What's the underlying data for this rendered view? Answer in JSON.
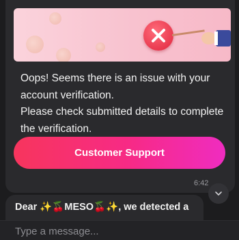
{
  "message": {
    "lines": [
      "Oops! Seems there is an issue with your account verification.",
      "Please check submitted details to complete the verification."
    ],
    "button_label": "Customer Support",
    "timestamp": "6:42"
  },
  "next_message": {
    "preview": "Dear ✨🍒MESO🍒✨, we detected a"
  },
  "composer": {
    "placeholder": "Type a message..."
  },
  "icons": {
    "banner_badge": "x-circle-icon",
    "scroll": "chevron-down-icon"
  },
  "colors": {
    "button_gradient_start": "#f7355d",
    "button_gradient_end": "#ef2cc0",
    "badge_red": "#e0243c",
    "background": "#1c1c1e",
    "bubble": "#2a2a2d"
  }
}
